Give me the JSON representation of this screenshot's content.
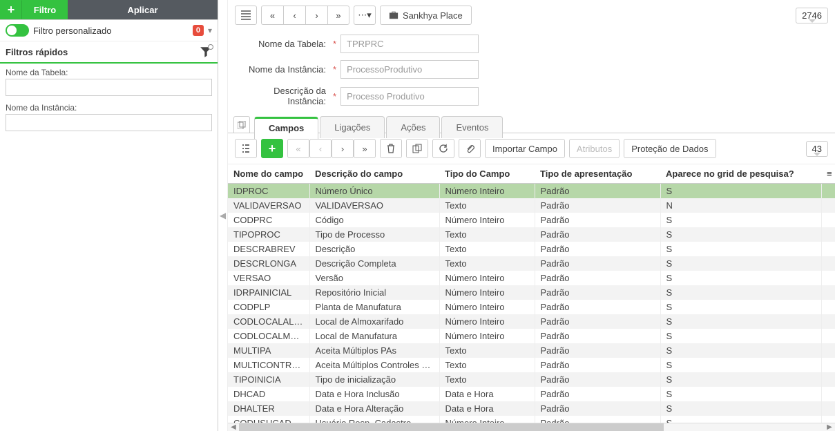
{
  "sidebar": {
    "filtro_button": "Filtro",
    "aplicar_button": "Aplicar",
    "custom_filter_label": "Filtro personalizado",
    "custom_filter_badge": "0",
    "quick_filters_title": "Filtros rápidos",
    "fields": {
      "tabela_label": "Nome da Tabela:",
      "instancia_label": "Nome da Instância:"
    }
  },
  "top": {
    "place_label": "Sankhya Place",
    "record_count": "2746"
  },
  "form": {
    "tabela_label": "Nome da Tabela:",
    "tabela_value": "TPRPRC",
    "instancia_label": "Nome da Instância:",
    "instancia_value": "ProcessoProdutivo",
    "descricao_label": "Descrição da Instância:",
    "descricao_value": "Processo Produtivo"
  },
  "tabs": [
    "Campos",
    "Ligações",
    "Ações",
    "Eventos"
  ],
  "sub": {
    "importar": "Importar Campo",
    "atributos": "Atributos",
    "protecao": "Proteção de Dados",
    "row_count": "43"
  },
  "grid": {
    "headers": [
      "Nome do campo",
      "Descrição do campo",
      "Tipo do Campo",
      "Tipo de apresentação",
      "Aparece no grid de pesquisa?"
    ],
    "rows": [
      [
        "IDPROC",
        "Número Único",
        "Número Inteiro",
        "Padrão",
        "S"
      ],
      [
        "VALIDAVERSAO",
        "VALIDAVERSAO",
        "Texto",
        "Padrão",
        "N"
      ],
      [
        "CODPRC",
        "Código",
        "Número Inteiro",
        "Padrão",
        "S"
      ],
      [
        "TIPOPROC",
        "Tipo de Processo",
        "Texto",
        "Padrão",
        "S"
      ],
      [
        "DESCRABREV",
        "Descrição",
        "Texto",
        "Padrão",
        "S"
      ],
      [
        "DESCRLONGA",
        "Descrição Completa",
        "Texto",
        "Padrão",
        "S"
      ],
      [
        "VERSAO",
        "Versão",
        "Número Inteiro",
        "Padrão",
        "S"
      ],
      [
        "IDRPAINICIAL",
        "Repositório Inicial",
        "Número Inteiro",
        "Padrão",
        "S"
      ],
      [
        "CODPLP",
        "Planta de Manufatura",
        "Número Inteiro",
        "Padrão",
        "S"
      ],
      [
        "CODLOCALALMOX",
        "Local de Almoxarifado",
        "Número Inteiro",
        "Padrão",
        "S"
      ],
      [
        "CODLOCALMANU",
        "Local de Manufatura",
        "Número Inteiro",
        "Padrão",
        "S"
      ],
      [
        "MULTIPA",
        "Aceita Múltiplos PAs",
        "Texto",
        "Padrão",
        "S"
      ],
      [
        "MULTICONTROLE",
        "Aceita Múltiplos Controles de P.",
        "Texto",
        "Padrão",
        "S"
      ],
      [
        "TIPOINICIA",
        "Tipo de inicialização",
        "Texto",
        "Padrão",
        "S"
      ],
      [
        "DHCAD",
        "Data e Hora Inclusão",
        "Data e Hora",
        "Padrão",
        "S"
      ],
      [
        "DHALTER",
        "Data e Hora Alteração",
        "Data e Hora",
        "Padrão",
        "S"
      ],
      [
        "CODUSUCAD",
        "Usuário Resp. Cadastro",
        "Número Inteiro",
        "Padrão",
        "S"
      ]
    ]
  }
}
